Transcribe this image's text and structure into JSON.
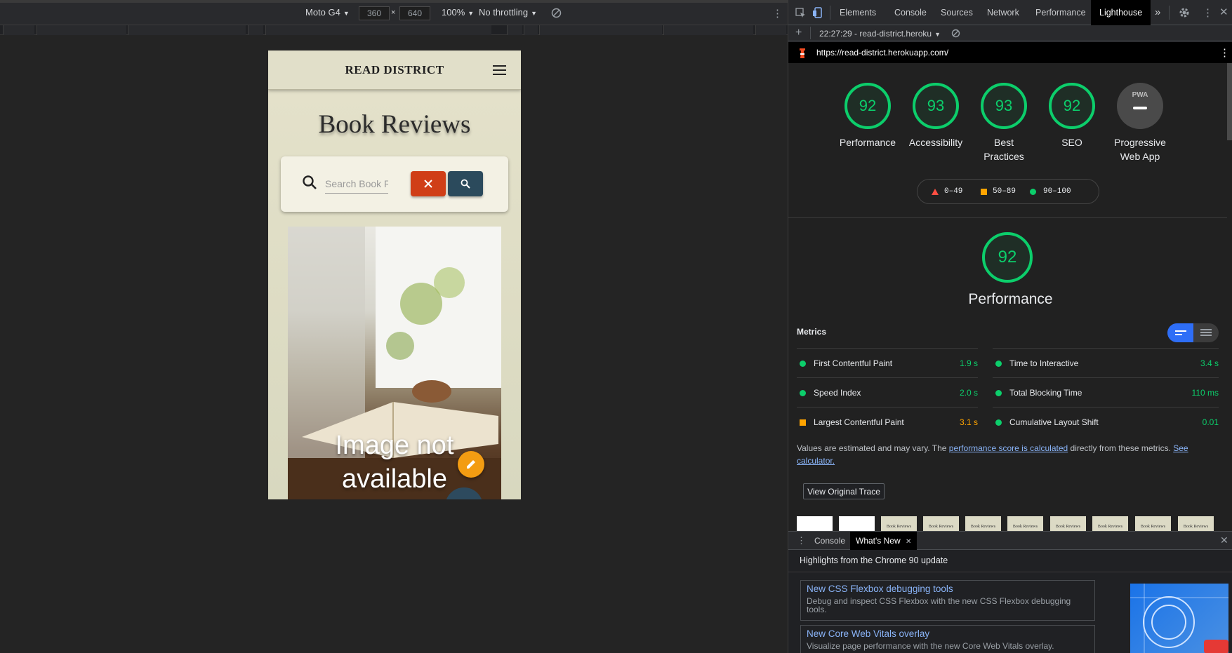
{
  "device_toolbar": {
    "device": "Moto G4",
    "width": "360",
    "height": "640",
    "times": "×",
    "zoom": "100%",
    "throttling": "No throttling"
  },
  "site": {
    "brand": "READ DISTRICT",
    "heading": "Book Reviews",
    "search_placeholder": "Search Book Reviews",
    "image_text": "Image not available"
  },
  "devtools": {
    "tabs": [
      "Elements",
      "Console",
      "Sources",
      "Network",
      "Performance",
      "Lighthouse"
    ],
    "more": "»",
    "report_label": "22:27:29 - read-district.heroku",
    "url": "https://read-district.herokuapp.com/",
    "scores": [
      {
        "value": "92",
        "label": "Performance"
      },
      {
        "value": "93",
        "label": "Accessibility"
      },
      {
        "value": "93",
        "label": "Best Practices"
      },
      {
        "value": "92",
        "label": "SEO"
      }
    ],
    "pwa": {
      "badge": "PWA",
      "label": "Progressive Web App"
    },
    "legend": [
      {
        "range": "0–49",
        "color": "#ff4e42"
      },
      {
        "range": "50–89",
        "color": "#ffa400"
      },
      {
        "range": "90–100",
        "color": "#0cce6b"
      }
    ],
    "performance": {
      "score": "92",
      "title": "Performance",
      "metrics_label": "Metrics",
      "metrics": [
        {
          "name": "First Contentful Paint",
          "value": "1.9 s",
          "status": "good"
        },
        {
          "name": "Time to Interactive",
          "value": "3.4 s",
          "status": "good"
        },
        {
          "name": "Speed Index",
          "value": "2.0 s",
          "status": "good"
        },
        {
          "name": "Total Blocking Time",
          "value": "110 ms",
          "status": "good"
        },
        {
          "name": "Largest Contentful Paint",
          "value": "3.1 s",
          "status": "average"
        },
        {
          "name": "Cumulative Layout Shift",
          "value": "0.01",
          "status": "good"
        }
      ],
      "note_prefix": "Values are estimated and may vary. The ",
      "note_link1": "performance score is calculated",
      "note_middle": " directly from these metrics. ",
      "note_link2": "See calculator.",
      "trace_button": "View Original Trace",
      "thumb_title": "Book Reviews"
    },
    "drawer": {
      "tabs": [
        "Console",
        "What's New"
      ],
      "heading": "Highlights from the Chrome 90 update",
      "items": [
        {
          "title": "New CSS Flexbox debugging tools",
          "desc": "Debug and inspect CSS Flexbox with the new CSS Flexbox debugging tools."
        },
        {
          "title": "New Core Web Vitals overlay",
          "desc": "Visualize page performance with the new Core Web Vitals overlay."
        }
      ]
    },
    "colors": {
      "good": "#0cce6b",
      "average": "#ffa400",
      "poor": "#ff4e42",
      "accent": "#8ab4f8"
    }
  }
}
